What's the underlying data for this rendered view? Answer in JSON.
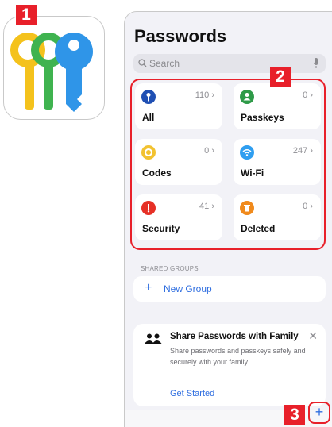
{
  "callouts": [
    "1",
    "2",
    "3"
  ],
  "app": {
    "title": "Passwords",
    "search_placeholder": "Search",
    "icons": [
      "search-icon",
      "microphone-icon"
    ]
  },
  "categories": [
    {
      "label": "All",
      "count": "110",
      "icon": "key-icon",
      "color": "#1f4fb3"
    },
    {
      "label": "Passkeys",
      "count": "0",
      "icon": "person-icon",
      "color": "#2e9a48"
    },
    {
      "label": "Codes",
      "count": "0",
      "icon": "code-icon",
      "color": "#f2c230"
    },
    {
      "label": "Wi-Fi",
      "count": "247",
      "icon": "wifi-icon",
      "color": "#2f9ef0"
    },
    {
      "label": "Security",
      "count": "41",
      "icon": "exclamation-icon",
      "color": "#e63026"
    },
    {
      "label": "Deleted",
      "count": "0",
      "icon": "trash-icon",
      "color": "#f08a1c"
    }
  ],
  "shared_groups": {
    "header": "SHARED GROUPS",
    "new_group_label": "New Group"
  },
  "family": {
    "title": "Share Passwords with Family",
    "description": "Share passwords and passkeys safely and securely with your family.",
    "cta": "Get Started"
  },
  "add_icon": "plus-icon",
  "colors": {
    "accent": "#2f6ee0",
    "callout": "#e8202a"
  }
}
